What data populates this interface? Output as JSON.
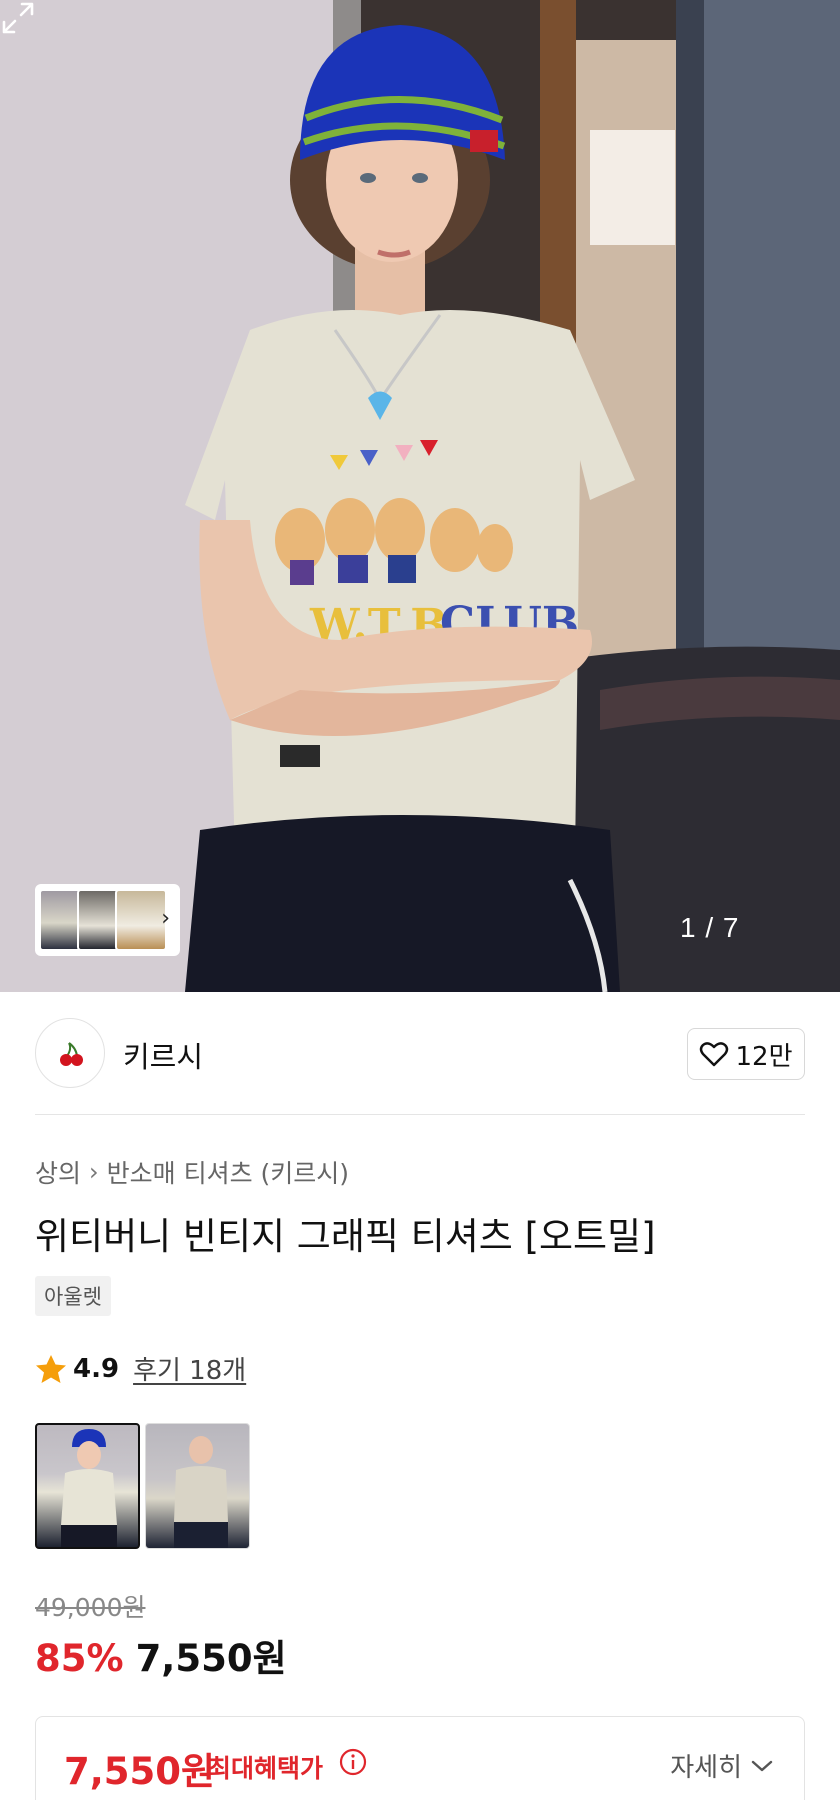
{
  "gallery": {
    "counter": "1 / 7",
    "strip_next_icon": "chevron-right-icon",
    "expand_icon": "expand-icon"
  },
  "brand": {
    "name": "키르시",
    "logo_icon": "cherry-icon",
    "like_icon": "heart-icon",
    "likes": "12만"
  },
  "breadcrumb": [
    "상의",
    "반소매 티셔츠 (키르시)"
  ],
  "product": {
    "title": "위티버니 빈티지 그래픽 티셔츠 [오트밀]",
    "tag": "아울렛"
  },
  "rating": {
    "star_icon": "star-icon",
    "score": "4.9",
    "reviews": "후기 18개"
  },
  "color_options": {
    "count": 2,
    "selected_index": 0
  },
  "price": {
    "original": "49,000원",
    "discount": "85%",
    "final": "7,550원"
  },
  "benefit": {
    "price": "7,550원",
    "label": "최대혜택가",
    "info_icon": "info-icon",
    "more": "자세히",
    "more_icon": "chevron-down-icon"
  },
  "colors": {
    "accent_red": "#e0262c",
    "text": "#111111"
  }
}
